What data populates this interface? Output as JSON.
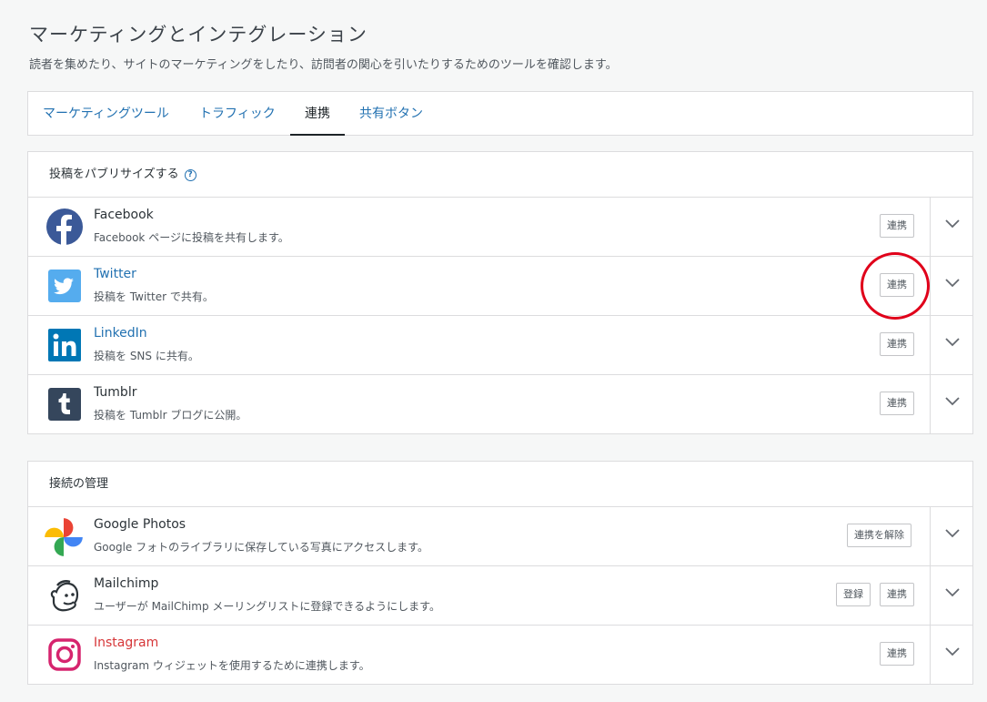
{
  "header": {
    "title": "マーケティングとインテグレーション",
    "subtitle": "読者を集めたり、サイトのマーケティングをしたり、訪問者の関心を引いたりするためのツールを確認します。"
  },
  "tabs": [
    {
      "label": "マーケティングツール",
      "active": false
    },
    {
      "label": "トラフィック",
      "active": false
    },
    {
      "label": "連携",
      "active": true
    },
    {
      "label": "共有ボタン",
      "active": false
    }
  ],
  "publicize": {
    "heading": "投稿をパブリサイズする",
    "help_icon": "question-circle-icon",
    "services": [
      {
        "name": "Facebook",
        "desc": "Facebook ページに投稿を共有します。",
        "icon": "facebook-icon",
        "color": "#3b5998",
        "button": "連携"
      },
      {
        "name": "Twitter",
        "desc": "投稿を Twitter で共有。",
        "icon": "twitter-icon",
        "color": "#55acee",
        "button": "連携"
      },
      {
        "name": "LinkedIn",
        "desc": "投稿を SNS に共有。",
        "icon": "linkedin-icon",
        "color": "#0077b5",
        "button": "連携"
      },
      {
        "name": "Tumblr",
        "desc": "投稿を Tumblr ブログに公開。",
        "icon": "tumblr-icon",
        "color": "#35465c",
        "button": "連携"
      }
    ]
  },
  "connections": {
    "heading": "接続の管理",
    "services": [
      {
        "name": "Google Photos",
        "desc": "Google フォトのライブラリに保存している写真にアクセスします。",
        "icon": "google-photos-icon",
        "button": "連携を解除"
      },
      {
        "name": "Mailchimp",
        "desc": "ユーザーが MailChimp メーリングリストに登録できるようにします。",
        "icon": "mailchimp-icon",
        "button": "連携",
        "secondary_button": "登録"
      },
      {
        "name": "Instagram",
        "desc": "Instagram ウィジェットを使用するために連携します。",
        "icon": "instagram-icon",
        "color": "#d6246e",
        "button": "連携"
      }
    ]
  },
  "colors": {
    "accent": "#2271b1",
    "annotation": "#e0001a"
  }
}
